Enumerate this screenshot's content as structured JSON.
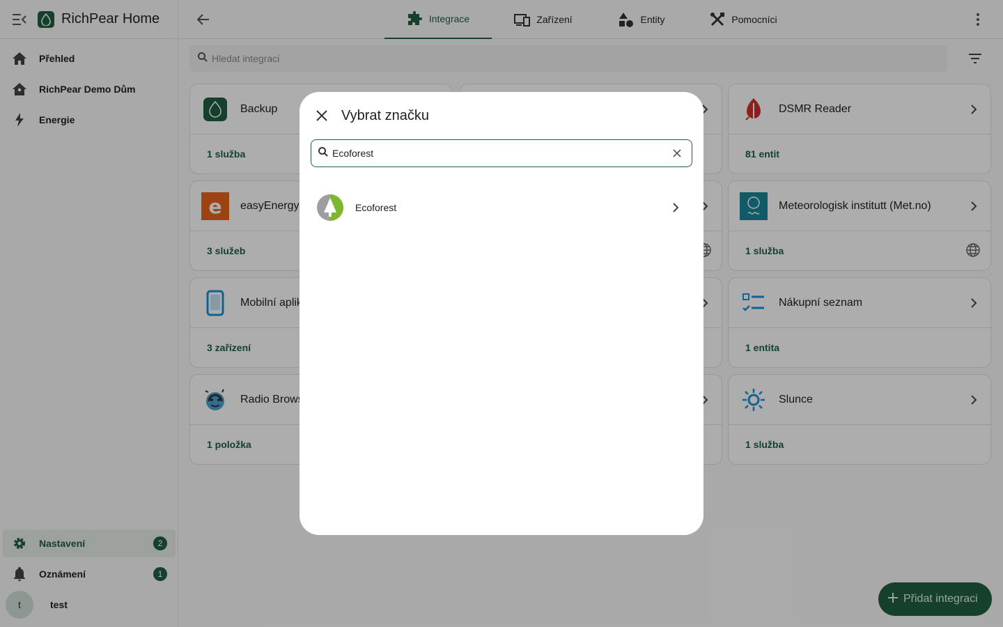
{
  "app": {
    "title": "RichPear Home"
  },
  "sidebar": {
    "items": [
      {
        "label": "Přehled",
        "icon": "home-icon"
      },
      {
        "label": "RichPear Demo Dům",
        "icon": "home-account-icon"
      },
      {
        "label": "Energie",
        "icon": "lightning-bolt-icon"
      }
    ],
    "bottom": {
      "settings": {
        "label": "Nastavení",
        "badge": "2"
      },
      "notifications": {
        "label": "Oznámení",
        "badge": "1"
      },
      "user": {
        "label": "test",
        "initial": "t"
      }
    }
  },
  "tabs": [
    {
      "label": "Integrace",
      "icon": "puzzle-icon",
      "active": true
    },
    {
      "label": "Zařízení",
      "icon": "devices-icon",
      "active": false
    },
    {
      "label": "Entity",
      "icon": "shapes-icon",
      "active": false
    },
    {
      "label": "Pomocníci",
      "icon": "tools-icon",
      "active": false
    }
  ],
  "search": {
    "placeholder": "Hledat integraci"
  },
  "cards": [
    {
      "name": "Backup",
      "meta": "1 služba"
    },
    {
      "name": "DSMR Reader",
      "meta": "81 entit"
    },
    {
      "name": "easyEnergy",
      "meta": "3 služeb"
    },
    {
      "name": "Meteorologisk institutt (Met.no)",
      "meta": "1 služba"
    },
    {
      "name": "Mobilní aplikace",
      "meta": "3 zařízení"
    },
    {
      "name": "Nákupní seznam",
      "meta": "1 entita"
    },
    {
      "name": "Radio Browser",
      "meta": "1 položka"
    },
    {
      "name": "Slunce",
      "meta": "1 služba"
    }
  ],
  "dialog": {
    "title": "Vybrat značku",
    "search_value": "Ecoforest",
    "results": [
      {
        "name": "Ecoforest"
      }
    ]
  },
  "fab": {
    "label": "Přidat integraci"
  },
  "colors": {
    "accent": "#1e5f42",
    "scrim": "rgba(0,0,0,0.32)"
  }
}
